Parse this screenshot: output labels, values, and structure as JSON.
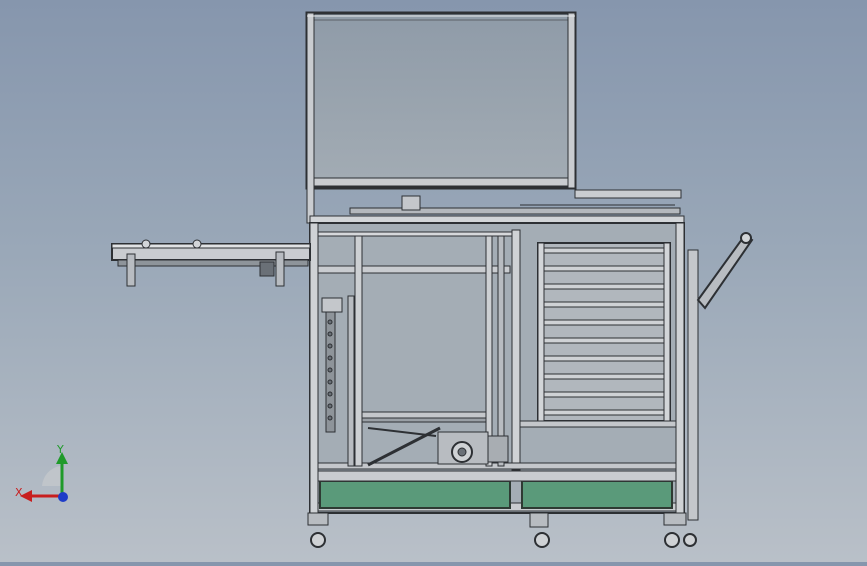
{
  "window": {
    "background_top": "#8696ad",
    "background_bottom": "#b9c0c8"
  },
  "model": {
    "frame_color": "#3a3d42",
    "frame_highlight": "#d4d7da",
    "glass_color": "#97a3ae",
    "panel_color": "#5a9a7a",
    "panel_edge": "#2e3a33"
  },
  "triad": {
    "x_label": "X",
    "y_label": "Y",
    "x_color": "#c81e1e",
    "y_color": "#1f9a2a",
    "z_color": "#1e3cc8"
  }
}
